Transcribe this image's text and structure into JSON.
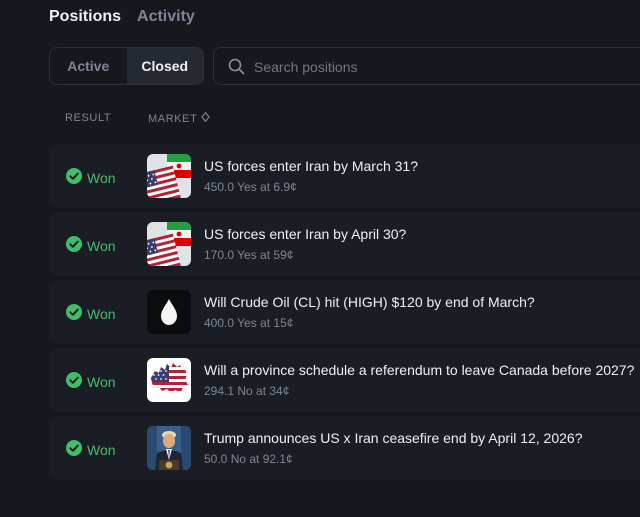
{
  "header": {
    "tabs": [
      {
        "label": "Positions",
        "active": true
      },
      {
        "label": "Activity",
        "active": false
      }
    ]
  },
  "toggle": {
    "active_label": "Active",
    "closed_label": "Closed",
    "selected": "Closed"
  },
  "search": {
    "placeholder": "Search positions",
    "value": ""
  },
  "table": {
    "columns": [
      "RESULT",
      "MARKET"
    ],
    "rows": [
      {
        "result": "Won",
        "title": "US forces enter Iran by March 31?",
        "detail": "450.0 Yes at 6.9¢",
        "image": "us-iran-flags"
      },
      {
        "result": "Won",
        "title": "US forces enter Iran by April 30?",
        "detail": "170.0 Yes at 59¢",
        "image": "us-iran-flags"
      },
      {
        "result": "Won",
        "title": "Will Crude Oil (CL) hit (HIGH) $120 by end of March?",
        "detail": "400.0 Yes at 15¢",
        "image": "oil-drop"
      },
      {
        "result": "Won",
        "title": "Will a province schedule a referendum to leave Canada before 2027?",
        "detail": "294.1 No at 34¢",
        "image": "us-flag-canada-map"
      },
      {
        "result": "Won",
        "title": "Trump announces US x Iran ceasefire end by April 12, 2026?",
        "detail": "50.0 No at 92.1¢",
        "image": "trump-podium"
      }
    ]
  },
  "colors": {
    "background": "#15181d",
    "row": "#1a1e24",
    "won": "#3fbf6b",
    "muted": "#7d8694"
  }
}
